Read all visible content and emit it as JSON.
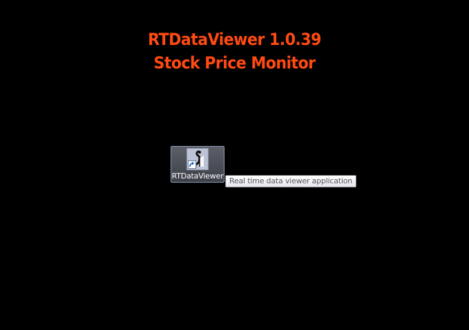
{
  "banner": {
    "line1": "RTDataViewer 1.0.39",
    "line2": "Stock Price Monitor",
    "color": "#ff4a12"
  },
  "desktop_icon": {
    "label": "RTDataViewer",
    "icon": "rtdataviewer-app-icon",
    "overlay_icon": "shortcut-arrow-icon",
    "state": "hover"
  },
  "tooltip": {
    "text": "Real time data viewer application"
  },
  "colors": {
    "background": "#000000",
    "selection_border": "#8a9bb4"
  }
}
